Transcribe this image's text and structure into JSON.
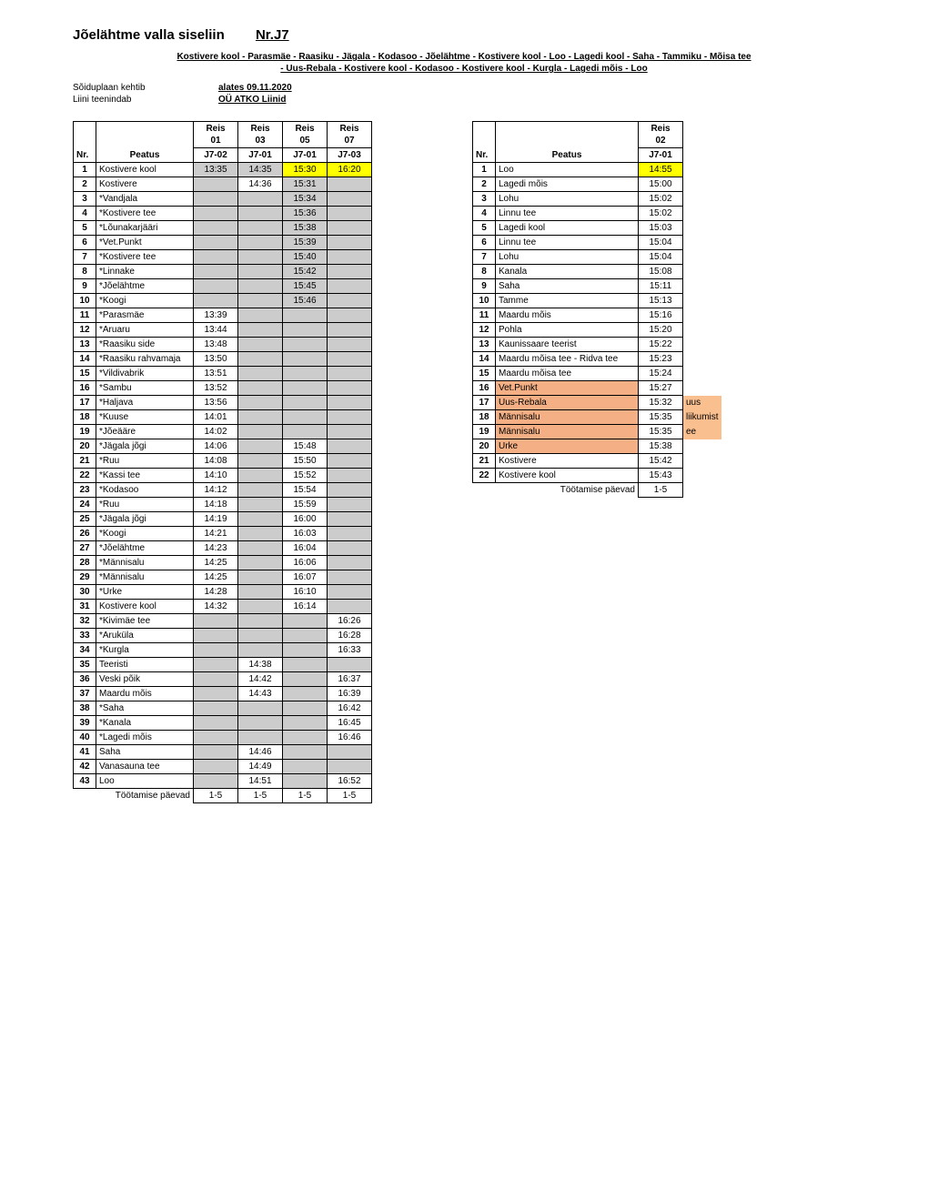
{
  "header": {
    "title_a": "Jõelähtme valla siseliin",
    "title_b": "Nr.J7",
    "route1": "Kostivere kool - Parasmäe - Raasiku - Jägala - Kodasoo - Jõelähtme - Kostivere kool - Loo - Lagedi kool - Saha - Tammiku - Mõisa tee",
    "route2": "- Uus-Rebala - Kostivere kool - Kodasoo - Kostivere kool  - Kurgla - Lagedi mõis - Loo",
    "valid_label": "Sõiduplaan kehtib",
    "valid_value": "alates 09.11.2020",
    "operator_label": "Liini teenindab",
    "operator_value": "OÜ ATKO Liinid"
  },
  "t1": {
    "head": {
      "nr": "Nr.",
      "stop": "Peatus",
      "trip": "Reis",
      "cols": [
        "01",
        "03",
        "05",
        "07"
      ],
      "codes": [
        "J7-02",
        "J7-01",
        "J7-01",
        "J7-03"
      ]
    },
    "rows": [
      {
        "n": "1",
        "s": "Kostivere kool",
        "t": [
          "13:35",
          "14:35",
          "15:30",
          "16:20"
        ],
        "c": [
          "grey",
          "grey",
          "yellow",
          "yellow"
        ]
      },
      {
        "n": "2",
        "s": "Kostivere",
        "t": [
          "",
          "14:36",
          "15:31",
          ""
        ],
        "c": [
          "grey",
          "",
          "grey",
          "grey"
        ]
      },
      {
        "n": "3",
        "s": "*Vandjala",
        "t": [
          "",
          "",
          "15:34",
          ""
        ],
        "c": [
          "grey",
          "grey",
          "grey",
          "grey"
        ]
      },
      {
        "n": "4",
        "s": "*Kostivere tee",
        "t": [
          "",
          "",
          "15:36",
          ""
        ],
        "c": [
          "grey",
          "grey",
          "grey",
          "grey"
        ]
      },
      {
        "n": "5",
        "s": "*Lõunakarjääri",
        "t": [
          "",
          "",
          "15:38",
          ""
        ],
        "c": [
          "grey",
          "grey",
          "grey",
          "grey"
        ]
      },
      {
        "n": "6",
        "s": "*Vet.Punkt",
        "t": [
          "",
          "",
          "15:39",
          ""
        ],
        "c": [
          "grey",
          "grey",
          "grey",
          "grey"
        ]
      },
      {
        "n": "7",
        "s": "*Kostivere tee",
        "t": [
          "",
          "",
          "15:40",
          ""
        ],
        "c": [
          "grey",
          "grey",
          "grey",
          "grey"
        ]
      },
      {
        "n": "8",
        "s": "*Linnake",
        "t": [
          "",
          "",
          "15:42",
          ""
        ],
        "c": [
          "grey",
          "grey",
          "grey",
          "grey"
        ]
      },
      {
        "n": "9",
        "s": "*Jõelähtme",
        "t": [
          "",
          "",
          "15:45",
          ""
        ],
        "c": [
          "grey",
          "grey",
          "grey",
          "grey"
        ]
      },
      {
        "n": "10",
        "s": "*Koogi",
        "t": [
          "",
          "",
          "15:46",
          ""
        ],
        "c": [
          "grey",
          "grey",
          "grey",
          "grey"
        ]
      },
      {
        "n": "11",
        "s": "*Parasmäe",
        "t": [
          "13:39",
          "",
          "",
          ""
        ],
        "c": [
          "",
          "grey",
          "grey",
          "grey"
        ]
      },
      {
        "n": "12",
        "s": "*Aruaru",
        "t": [
          "13:44",
          "",
          "",
          ""
        ],
        "c": [
          "",
          "grey",
          "grey",
          "grey"
        ]
      },
      {
        "n": "13",
        "s": "*Raasiku side",
        "t": [
          "13:48",
          "",
          "",
          ""
        ],
        "c": [
          "",
          "grey",
          "grey",
          "grey"
        ]
      },
      {
        "n": "14",
        "s": "*Raasiku rahvamaja",
        "t": [
          "13:50",
          "",
          "",
          ""
        ],
        "c": [
          "",
          "grey",
          "grey",
          "grey"
        ]
      },
      {
        "n": "15",
        "s": "*Vildivabrik",
        "t": [
          "13:51",
          "",
          "",
          ""
        ],
        "c": [
          "",
          "grey",
          "grey",
          "grey"
        ]
      },
      {
        "n": "16",
        "s": "*Sambu",
        "t": [
          "13:52",
          "",
          "",
          ""
        ],
        "c": [
          "",
          "grey",
          "grey",
          "grey"
        ]
      },
      {
        "n": "17",
        "s": "*Haljava",
        "t": [
          "13:56",
          "",
          "",
          ""
        ],
        "c": [
          "",
          "grey",
          "grey",
          "grey"
        ]
      },
      {
        "n": "18",
        "s": "*Kuuse",
        "t": [
          "14:01",
          "",
          "",
          ""
        ],
        "c": [
          "",
          "grey",
          "grey",
          "grey"
        ]
      },
      {
        "n": "19",
        "s": "*Jõeääre",
        "t": [
          "14:02",
          "",
          "",
          ""
        ],
        "c": [
          "",
          "grey",
          "grey",
          "grey"
        ]
      },
      {
        "n": "20",
        "s": "*Jägala jõgi",
        "t": [
          "14:06",
          "",
          "15:48",
          ""
        ],
        "c": [
          "",
          "grey",
          "",
          "grey"
        ]
      },
      {
        "n": "21",
        "s": "*Ruu",
        "t": [
          "14:08",
          "",
          "15:50",
          ""
        ],
        "c": [
          "",
          "grey",
          "",
          "grey"
        ]
      },
      {
        "n": "22",
        "s": "*Kassi tee",
        "t": [
          "14:10",
          "",
          "15:52",
          ""
        ],
        "c": [
          "",
          "grey",
          "",
          "grey"
        ]
      },
      {
        "n": "23",
        "s": "*Kodasoo",
        "t": [
          "14:12",
          "",
          "15:54",
          ""
        ],
        "c": [
          "",
          "grey",
          "",
          "grey"
        ]
      },
      {
        "n": "24",
        "s": "*Ruu",
        "t": [
          "14:18",
          "",
          "15:59",
          ""
        ],
        "c": [
          "",
          "grey",
          "",
          "grey"
        ]
      },
      {
        "n": "25",
        "s": "*Jägala jõgi",
        "t": [
          "14:19",
          "",
          "16:00",
          ""
        ],
        "c": [
          "",
          "grey",
          "",
          "grey"
        ]
      },
      {
        "n": "26",
        "s": "*Koogi",
        "t": [
          "14:21",
          "",
          "16:03",
          ""
        ],
        "c": [
          "",
          "grey",
          "",
          "grey"
        ]
      },
      {
        "n": "27",
        "s": "*Jõelähtme",
        "t": [
          "14:23",
          "",
          "16:04",
          ""
        ],
        "c": [
          "",
          "grey",
          "",
          "grey"
        ]
      },
      {
        "n": "28",
        "s": "*Männisalu",
        "t": [
          "14:25",
          "",
          "16:06",
          ""
        ],
        "c": [
          "",
          "grey",
          "",
          "grey"
        ]
      },
      {
        "n": "29",
        "s": "*Männisalu",
        "t": [
          "14:25",
          "",
          "16:07",
          ""
        ],
        "c": [
          "",
          "grey",
          "",
          "grey"
        ]
      },
      {
        "n": "30",
        "s": "*Urke",
        "t": [
          "14:28",
          "",
          "16:10",
          ""
        ],
        "c": [
          "",
          "grey",
          "",
          "grey"
        ]
      },
      {
        "n": "31",
        "s": "Kostivere kool",
        "t": [
          "14:32",
          "",
          "16:14",
          ""
        ],
        "c": [
          "",
          "grey",
          "",
          "grey"
        ]
      },
      {
        "n": "32",
        "s": "*Kivimäe tee",
        "t": [
          "",
          "",
          "",
          "16:26"
        ],
        "c": [
          "grey",
          "grey",
          "grey",
          ""
        ]
      },
      {
        "n": "33",
        "s": "*Aruküla",
        "t": [
          "",
          "",
          "",
          "16:28"
        ],
        "c": [
          "grey",
          "grey",
          "grey",
          ""
        ]
      },
      {
        "n": "34",
        "s": "*Kurgla",
        "t": [
          "",
          "",
          "",
          "16:33"
        ],
        "c": [
          "grey",
          "grey",
          "grey",
          ""
        ]
      },
      {
        "n": "35",
        "s": "Teeristi",
        "t": [
          "",
          "14:38",
          "",
          ""
        ],
        "c": [
          "grey",
          "",
          "grey",
          "grey"
        ]
      },
      {
        "n": "36",
        "s": "Veski põik",
        "t": [
          "",
          "14:42",
          "",
          "16:37"
        ],
        "c": [
          "grey",
          "",
          "grey",
          ""
        ]
      },
      {
        "n": "37",
        "s": "Maardu mõis",
        "t": [
          "",
          "14:43",
          "",
          "16:39"
        ],
        "c": [
          "grey",
          "",
          "grey",
          ""
        ]
      },
      {
        "n": "38",
        "s": "*Saha",
        "t": [
          "",
          "",
          "",
          "16:42"
        ],
        "c": [
          "grey",
          "grey",
          "grey",
          ""
        ]
      },
      {
        "n": "39",
        "s": "*Kanala",
        "t": [
          "",
          "",
          "",
          "16:45"
        ],
        "c": [
          "grey",
          "grey",
          "grey",
          ""
        ]
      },
      {
        "n": "40",
        "s": "*Lagedi mõis",
        "t": [
          "",
          "",
          "",
          "16:46"
        ],
        "c": [
          "grey",
          "grey",
          "grey",
          ""
        ]
      },
      {
        "n": "41",
        "s": "Saha",
        "t": [
          "",
          "14:46",
          "",
          ""
        ],
        "c": [
          "grey",
          "",
          "grey",
          "grey"
        ]
      },
      {
        "n": "42",
        "s": "Vanasauna tee",
        "t": [
          "",
          "14:49",
          "",
          ""
        ],
        "c": [
          "grey",
          "",
          "grey",
          "grey"
        ]
      },
      {
        "n": "43",
        "s": "Loo",
        "t": [
          "",
          "14:51",
          "",
          "16:52"
        ],
        "c": [
          "grey",
          "",
          "grey",
          ""
        ]
      }
    ],
    "footer": {
      "label": "Töötamise päevad",
      "vals": [
        "1-5",
        "1-5",
        "1-5",
        "1-5"
      ]
    }
  },
  "t2": {
    "head": {
      "nr": "Nr.",
      "stop": "Peatus",
      "trip": "Reis",
      "cols": [
        "02"
      ],
      "codes": [
        "J7-01"
      ]
    },
    "rows": [
      {
        "n": "1",
        "s": "Loo",
        "t": [
          "14:55"
        ],
        "c": [
          "yellow"
        ],
        "sc": ""
      },
      {
        "n": "2",
        "s": "Lagedi mõis",
        "t": [
          "15:00"
        ],
        "c": [
          ""
        ],
        "sc": ""
      },
      {
        "n": "3",
        "s": "Lohu",
        "t": [
          "15:02"
        ],
        "c": [
          ""
        ],
        "sc": ""
      },
      {
        "n": "4",
        "s": "Linnu tee",
        "t": [
          "15:02"
        ],
        "c": [
          ""
        ],
        "sc": ""
      },
      {
        "n": "5",
        "s": "Lagedi kool",
        "t": [
          "15:03"
        ],
        "c": [
          ""
        ],
        "sc": ""
      },
      {
        "n": "6",
        "s": "Linnu tee",
        "t": [
          "15:04"
        ],
        "c": [
          ""
        ],
        "sc": ""
      },
      {
        "n": "7",
        "s": "Lohu",
        "t": [
          "15:04"
        ],
        "c": [
          ""
        ],
        "sc": ""
      },
      {
        "n": "8",
        "s": "Kanala",
        "t": [
          "15:08"
        ],
        "c": [
          ""
        ],
        "sc": ""
      },
      {
        "n": "9",
        "s": "Saha",
        "t": [
          "15:11"
        ],
        "c": [
          ""
        ],
        "sc": ""
      },
      {
        "n": "10",
        "s": "Tamme",
        "t": [
          "15:13"
        ],
        "c": [
          ""
        ],
        "sc": ""
      },
      {
        "n": "11",
        "s": "Maardu mõis",
        "t": [
          "15:16"
        ],
        "c": [
          ""
        ],
        "sc": ""
      },
      {
        "n": "12",
        "s": "Pohla",
        "t": [
          "15:20"
        ],
        "c": [
          ""
        ],
        "sc": ""
      },
      {
        "n": "13",
        "s": "Kaunissaare teerist",
        "t": [
          "15:22"
        ],
        "c": [
          ""
        ],
        "sc": ""
      },
      {
        "n": "14",
        "s": "Maardu mõisa tee - Ridva tee",
        "t": [
          "15:23"
        ],
        "c": [
          ""
        ],
        "sc": ""
      },
      {
        "n": "15",
        "s": "Maardu mõisa tee",
        "t": [
          "15:24"
        ],
        "c": [
          ""
        ],
        "sc": ""
      },
      {
        "n": "16",
        "s": "Vet.Punkt",
        "t": [
          "15:27"
        ],
        "c": [
          ""
        ],
        "sc": "salmon"
      },
      {
        "n": "17",
        "s": "Uus-Rebala",
        "t": [
          "15:32"
        ],
        "c": [
          ""
        ],
        "sc": "salmon",
        "note": "uus"
      },
      {
        "n": "18",
        "s": "Männisalu",
        "t": [
          "15:35"
        ],
        "c": [
          ""
        ],
        "sc": "salmon",
        "note": "liikumist"
      },
      {
        "n": "19",
        "s": "Männisalu",
        "t": [
          "15:35"
        ],
        "c": [
          ""
        ],
        "sc": "salmon",
        "note": "ee"
      },
      {
        "n": "20",
        "s": "Urke",
        "t": [
          "15:38"
        ],
        "c": [
          ""
        ],
        "sc": "salmon"
      },
      {
        "n": "21",
        "s": "Kostivere",
        "t": [
          "15:42"
        ],
        "c": [
          ""
        ],
        "sc": ""
      },
      {
        "n": "22",
        "s": "Kostivere kool",
        "t": [
          "15:43"
        ],
        "c": [
          ""
        ],
        "sc": ""
      }
    ],
    "footer": {
      "label": "Töötamise päevad",
      "vals": [
        "1-5"
      ]
    }
  }
}
